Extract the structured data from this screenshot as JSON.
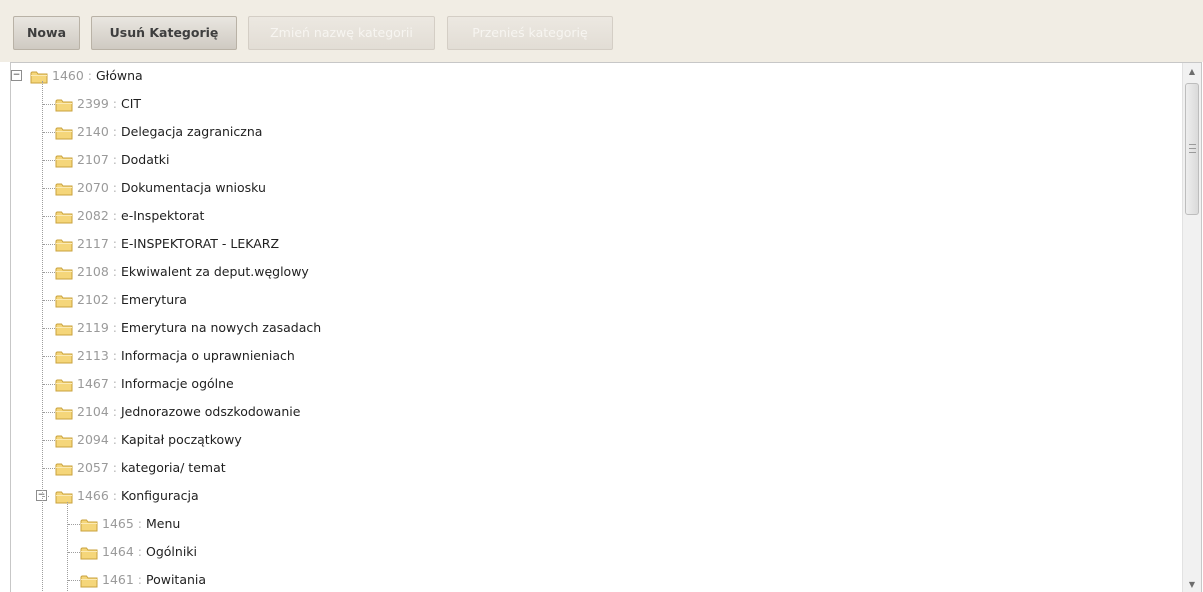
{
  "toolbar": {
    "new_label": "Nowa",
    "delete_label": "Usuń Kategorię",
    "rename_label": "Zmień nazwę kategorii",
    "move_label": "Przenieś kategorię"
  },
  "tree": {
    "separator": ":",
    "root": {
      "id": "1460",
      "name": "Główna",
      "expanded": true
    },
    "children": [
      {
        "id": "2399",
        "name": "CIT"
      },
      {
        "id": "2140",
        "name": "Delegacja zagraniczna"
      },
      {
        "id": "2107",
        "name": "Dodatki"
      },
      {
        "id": "2070",
        "name": "Dokumentacja wniosku"
      },
      {
        "id": "2082",
        "name": "e-Inspektorat"
      },
      {
        "id": "2117",
        "name": "E-INSPEKTORAT - LEKARZ"
      },
      {
        "id": "2108",
        "name": "Ekwiwalent za deput.węglowy"
      },
      {
        "id": "2102",
        "name": "Emerytura"
      },
      {
        "id": "2119",
        "name": "Emerytura na nowych zasadach"
      },
      {
        "id": "2113",
        "name": "Informacja o uprawnieniach"
      },
      {
        "id": "1467",
        "name": "Informacje ogólne"
      },
      {
        "id": "2104",
        "name": "Jednorazowe odszkodowanie"
      },
      {
        "id": "2094",
        "name": "Kapitał początkowy"
      },
      {
        "id": "2057",
        "name": "kategoria/ temat"
      },
      {
        "id": "1466",
        "name": "Konfiguracja",
        "expanded": true
      }
    ],
    "konfiguracja_children": [
      {
        "id": "1465",
        "name": "Menu"
      },
      {
        "id": "1464",
        "name": "Ogólniki"
      },
      {
        "id": "1461",
        "name": "Powitania"
      }
    ]
  },
  "colors": {
    "toolbar_bg": "#f1ede4",
    "folder_fill": "#f5d67a",
    "folder_stroke": "#c9a23c",
    "id_text": "#9a9a9a"
  }
}
